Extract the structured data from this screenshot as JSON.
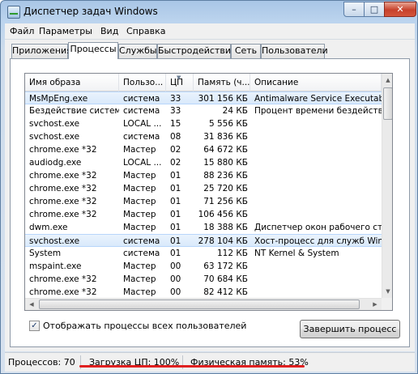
{
  "window": {
    "title": "Диспетчер задач Windows",
    "min_glyph": "–",
    "max_glyph": "□",
    "close_glyph": "✕"
  },
  "menu": [
    "Файл",
    "Параметры",
    "Вид",
    "Справка"
  ],
  "tabs": [
    {
      "label": "Приложения",
      "active": false
    },
    {
      "label": "Процессы",
      "active": true
    },
    {
      "label": "Службы",
      "active": false
    },
    {
      "label": "Быстродействие",
      "active": false
    },
    {
      "label": "Сеть",
      "active": false
    },
    {
      "label": "Пользователи",
      "active": false
    }
  ],
  "table": {
    "columns": [
      "Имя образа",
      "Пользо...",
      "ЦП",
      "Память (ч...",
      "Описание"
    ],
    "sorted_column": "ЦП",
    "rows": [
      [
        "MsMpEng.exe",
        "система",
        "33",
        "301 156 КБ",
        "Antimalware Service Executable"
      ],
      [
        "Бездействие системы",
        "система",
        "33",
        "24 КБ",
        "Процент времени бездействия п"
      ],
      [
        "svchost.exe",
        "LOCAL ...",
        "15",
        "5 556 КБ",
        ""
      ],
      [
        "svchost.exe",
        "система",
        "08",
        "31 836 КБ",
        ""
      ],
      [
        "chrome.exe *32",
        "Мастер",
        "02",
        "64 672 КБ",
        ""
      ],
      [
        "audiodg.exe",
        "LOCAL ...",
        "02",
        "15 880 КБ",
        ""
      ],
      [
        "chrome.exe *32",
        "Мастер",
        "01",
        "88 236 КБ",
        ""
      ],
      [
        "chrome.exe *32",
        "Мастер",
        "01",
        "25 720 КБ",
        ""
      ],
      [
        "chrome.exe *32",
        "Мастер",
        "01",
        "71 256 КБ",
        ""
      ],
      [
        "chrome.exe *32",
        "Мастер",
        "01",
        "106 456 КБ",
        ""
      ],
      [
        "dwm.exe",
        "Мастер",
        "01",
        "18 388 КБ",
        "Диспетчер окон рабочего стола"
      ],
      [
        "svchost.exe",
        "система",
        "01",
        "278 104 КБ",
        "Хост-процесс для служб Window"
      ],
      [
        "System",
        "система",
        "01",
        "112 КБ",
        "NT Kernel & System"
      ],
      [
        "mspaint.exe",
        "Мастер",
        "00",
        "63 172 КБ",
        ""
      ],
      [
        "chrome.exe *32",
        "Мастер",
        "00",
        "70 684 КБ",
        ""
      ],
      [
        "chrome.exe *32",
        "Мастер",
        "00",
        "82 412 КБ",
        ""
      ]
    ],
    "selected_rows": [
      0,
      11
    ]
  },
  "show_all_users": {
    "label": "Отображать процессы всех пользователей",
    "checked": true
  },
  "end_process_button": "Завершить процесс",
  "status": {
    "processes": "Процессов: 70",
    "cpu": "Загрузка ЦП: 100%",
    "memory": "Физическая память: 53%"
  },
  "colors": {
    "highlight_underline": "#e02020",
    "title_bar": "#bcd4ee",
    "close_button": "#c7412b"
  }
}
